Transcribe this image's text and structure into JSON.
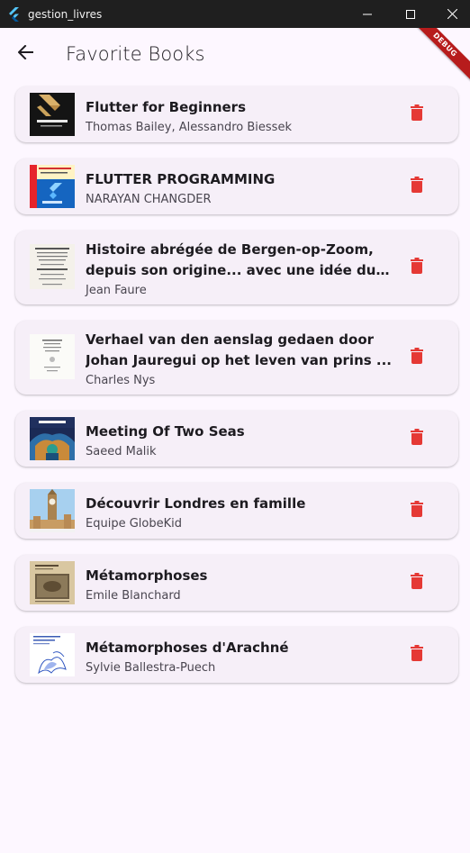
{
  "window": {
    "title": "gestion_livres",
    "minimize_icon": "minimize-icon",
    "maximize_icon": "maximize-icon",
    "close_icon": "close-icon"
  },
  "appbar": {
    "back_icon": "arrow-left-icon",
    "title": "Favorite Books"
  },
  "debug_banner": "DEBUG",
  "colors": {
    "background": "#fdf7ff",
    "card": "#f6eff8",
    "delete": "#e53935",
    "title_text": "#1d1b20",
    "author_text": "#49454f"
  },
  "books": [
    {
      "title": "Flutter for Beginners",
      "author": "Thomas Bailey, Alessandro Biessek",
      "cover_icon": "book-cover-flutter-for-beginners",
      "delete_icon": "trash-icon"
    },
    {
      "title": "FLUTTER PROGRAMMING",
      "author": "NARAYAN CHANGDER",
      "cover_icon": "book-cover-flutter-programming",
      "delete_icon": "trash-icon"
    },
    {
      "title": "Histoire abrégée de Bergen-op-Zoom, depuis son origine... avec une idée du fa...",
      "author": "Jean Faure",
      "cover_icon": "book-cover-histoire-bergen",
      "delete_icon": "trash-icon"
    },
    {
      "title": "Verhael van den aenslag gedaen door Johan Jauregui op het leven van prins ...",
      "author": "Charles Nys",
      "cover_icon": "book-cover-verhael",
      "delete_icon": "trash-icon"
    },
    {
      "title": "Meeting Of Two Seas",
      "author": "Saeed Malik",
      "cover_icon": "book-cover-meeting-of-two-seas",
      "delete_icon": "trash-icon"
    },
    {
      "title": "Découvrir Londres en famille",
      "author": "Equipe GlobeKid",
      "cover_icon": "book-cover-londres",
      "delete_icon": "trash-icon"
    },
    {
      "title": "Métamorphoses",
      "author": "Emile Blanchard",
      "cover_icon": "book-cover-metamorphoses",
      "delete_icon": "trash-icon"
    },
    {
      "title": "Métamorphoses d'Arachné",
      "author": "Sylvie Ballestra-Puech",
      "cover_icon": "book-cover-arachne",
      "delete_icon": "trash-icon"
    }
  ]
}
